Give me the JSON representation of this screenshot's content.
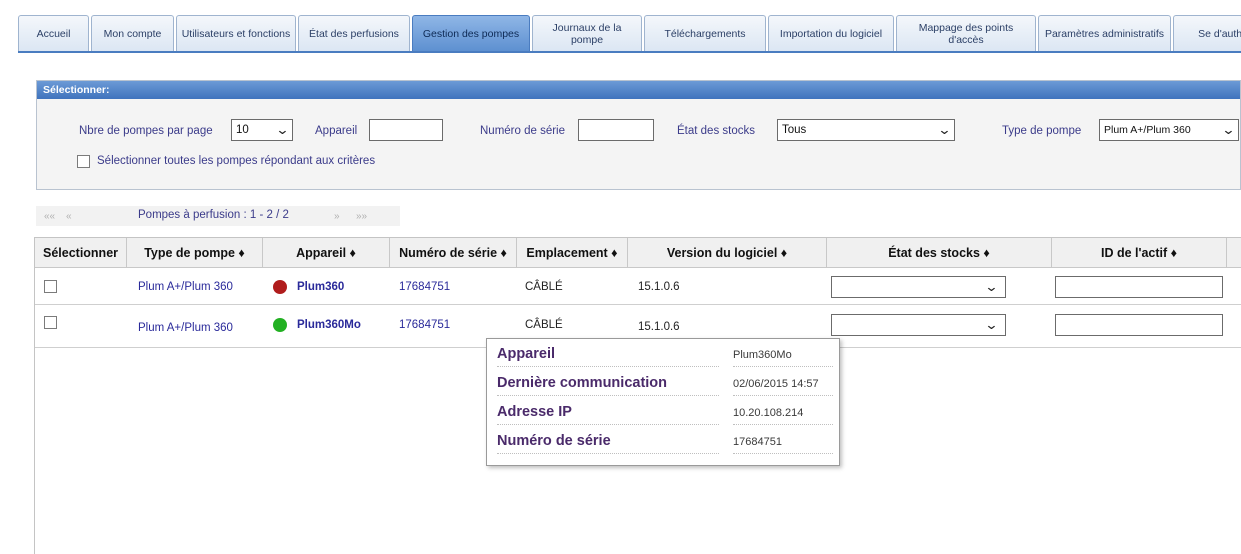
{
  "tabs": [
    {
      "label": "Accueil"
    },
    {
      "label": "Mon compte"
    },
    {
      "label": "Utilisateurs et fonctions"
    },
    {
      "label": "État des perfusions"
    },
    {
      "label": "Gestion des pompes"
    },
    {
      "label": "Journaux de la pompe"
    },
    {
      "label": "Téléchargements"
    },
    {
      "label": "Importation du logiciel"
    },
    {
      "label": "Mappage des points d'accès"
    },
    {
      "label": "Paramètres administratifs"
    },
    {
      "label": "Se d'authe"
    }
  ],
  "active_tab": "Gestion des pompes",
  "filter": {
    "header": "Sélectionner:",
    "per_page_label": "Nbre de pompes par page",
    "per_page_value": "10",
    "device_label": "Appareil",
    "device_value": "",
    "serial_label": "Numéro de série",
    "serial_value": "",
    "stock_label": "État des stocks",
    "stock_value": "Tous",
    "pump_type_label": "Type de pompe",
    "pump_type_value": "Plum A+/Plum 360",
    "select_all_label": "Sélectionner toutes les pompes répondant aux critères"
  },
  "pager": {
    "first": "«« ",
    "prev": "«",
    "text": "Pompes à perfusion : 1 - 2 / 2",
    "next": "»",
    "last": "»»"
  },
  "table": {
    "headers": [
      "Sélectionner",
      "Type de pompe ♦",
      "Appareil ♦",
      "Numéro de série ♦",
      "Emplacement ♦",
      "Version du logiciel ♦",
      "État des stocks ♦",
      "ID de l'actif ♦"
    ],
    "rows": [
      {
        "type": "Plum A+/Plum 360",
        "device": "Plum360",
        "status_color": "#b01c1c",
        "serial": "17684751",
        "location": "CÂBLÉ",
        "version": "15.1.0.6",
        "stock": "",
        "asset_id": ""
      },
      {
        "type": "Plum A+/Plum 360",
        "device": "Plum360Mo",
        "status_color": "#22b022",
        "serial": "17684751",
        "location": "CÂBLÉ",
        "version": "15.1.0.6",
        "stock": "",
        "asset_id": ""
      }
    ]
  },
  "tooltip": {
    "rows": [
      {
        "key": "Appareil",
        "value": "Plum360Mo"
      },
      {
        "key": "Dernière communication",
        "value": "02/06/2015 14:57"
      },
      {
        "key": "Adresse IP",
        "value": "10.20.108.214"
      },
      {
        "key": "Numéro de série",
        "value": "17684751"
      }
    ]
  },
  "colors": {
    "tab_active": "#5c8fd0",
    "panel_header": "#3f73bd",
    "label_text": "#3b3b8a"
  },
  "icons": {
    "select_chevron": "chevron-down-icon",
    "device_status": "status-dot-icon"
  }
}
